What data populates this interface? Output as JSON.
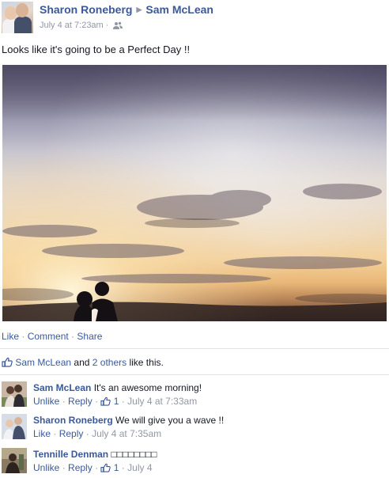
{
  "post": {
    "author": "Sharon Roneberg",
    "target": "Sam McLean",
    "arrow": "▶",
    "timestamp": "July 4 at 7:23am",
    "meta_sep": "·",
    "audience_icon": "friends-icon",
    "status_text": "Looks like it's going to be a Perfect Day !!"
  },
  "actions": {
    "like": "Like",
    "comment": "Comment",
    "share": "Share",
    "sep": "·"
  },
  "likes": {
    "icon": "thumbs-up-icon",
    "name": "Sam McLean",
    "and": "and",
    "others": "2 others",
    "suffix": "like this."
  },
  "comments": [
    {
      "name": "Sam McLean",
      "text": "It's an awesome morning!",
      "like_action": "Unlike",
      "reply": "Reply",
      "like_count": "1",
      "time": "July 4 at 7:33am"
    },
    {
      "name": "Sharon Roneberg",
      "text": "We will give you a wave !!",
      "like_action": "Like",
      "reply": "Reply",
      "like_count": "",
      "time": "July 4 at 7:35am"
    },
    {
      "name": "Tennille Denman",
      "text": "□□□□□□□□",
      "like_action": "Unlike",
      "reply": "Reply",
      "like_count": "1",
      "time": "July 4"
    }
  ],
  "colors": {
    "link": "#3b5998",
    "meta": "#9197a3",
    "divider": "#e1e2e3"
  }
}
